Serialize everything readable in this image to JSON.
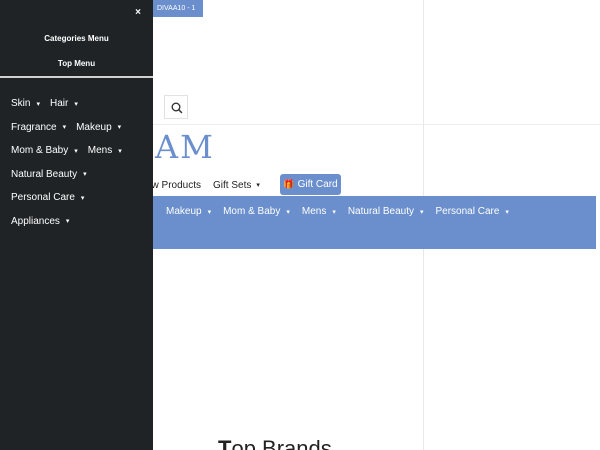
{
  "promo": {
    "text": "DIVAA10 - 1"
  },
  "logo": {
    "text": "AM"
  },
  "secondary_nav": {
    "items": [
      {
        "label": "ew Products",
        "caret": ""
      },
      {
        "label": "Gift Sets",
        "caret": "▾"
      }
    ],
    "gift_card": {
      "label": "Gift Card",
      "icon": "gift-icon"
    }
  },
  "category_bar": {
    "items": [
      {
        "label": "Makeup",
        "caret": "▾"
      },
      {
        "label": "Mom & Baby",
        "caret": "▾"
      },
      {
        "label": "Mens",
        "caret": "▾"
      },
      {
        "label": "Natural Beauty",
        "caret": "▾"
      },
      {
        "label": "Personal Care",
        "caret": "▾"
      }
    ]
  },
  "heading": {
    "bold": "T",
    "rest": "op Brands"
  },
  "drawer": {
    "close_icon": "×",
    "tabs": {
      "categories": "Categories Menu",
      "top": "Top Menu"
    },
    "rows": [
      [
        {
          "label": "Skin",
          "caret": "▾"
        },
        {
          "label": "Hair",
          "caret": "▾"
        }
      ],
      [
        {
          "label": "Fragrance",
          "caret": "▾"
        },
        {
          "label": "Makeup",
          "caret": "▾"
        }
      ],
      [
        {
          "label": "Mom & Baby",
          "caret": "▾"
        },
        {
          "label": "Mens",
          "caret": "▾"
        }
      ],
      [
        {
          "label": "Natural Beauty",
          "caret": "▾"
        }
      ],
      [
        {
          "label": "Personal Care",
          "caret": "▾"
        }
      ],
      [
        {
          "label": "Appliances",
          "caret": "▾"
        }
      ]
    ]
  },
  "colors": {
    "accent": "#6a8fcc",
    "drawer_bg": "#1f2326"
  }
}
